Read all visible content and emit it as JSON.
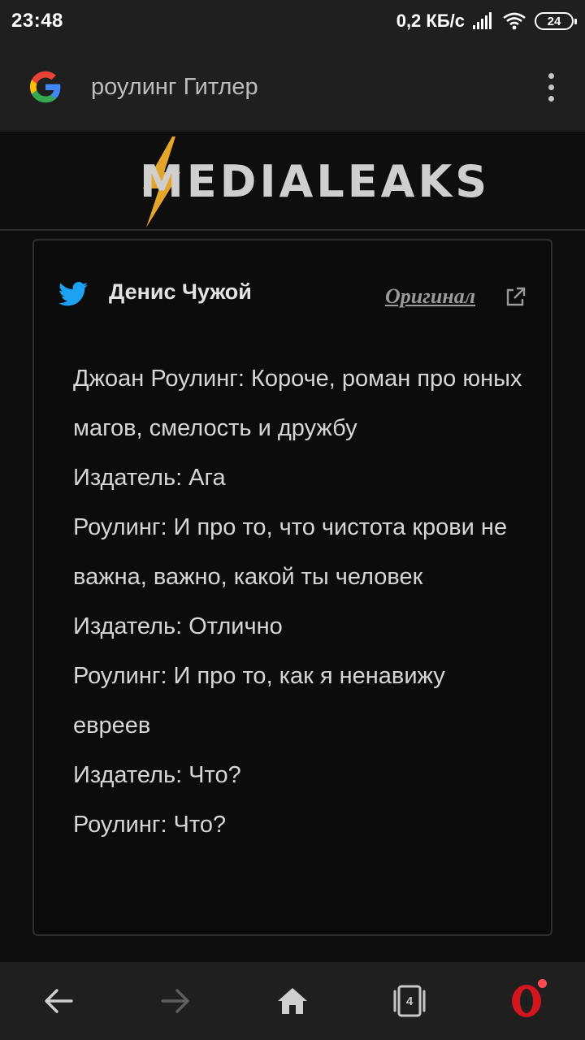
{
  "status_bar": {
    "time": "23:48",
    "speed": "0,2 КБ/с",
    "battery": "24",
    "icons": [
      "signal-icon",
      "wifi-icon",
      "battery-icon"
    ]
  },
  "search_bar": {
    "query": "роулинг Гитлер",
    "icons": [
      "google-logo-icon",
      "more-vertical-icon"
    ]
  },
  "site": {
    "logo_text": "MEDIALEAKS",
    "accent_color": "#e5a52a"
  },
  "tweet": {
    "author": "Денис Чужой",
    "original_label": "Оригинал",
    "lines": [
      "Джоан Роулинг: Короче, роман про юных магов, смелость и дружбу",
      "Издатель: Ага",
      "Роулинг: И про то, что чистота крови не важна, важно, какой ты человек",
      "Издатель: Отлично",
      "Роулинг: И про то, как я ненавижу евреев",
      "Издатель: Что?",
      "Роулинг: Что?"
    ],
    "twitter_color": "#1da1f2"
  },
  "nav_bar": {
    "tabs_count": "4",
    "icons": [
      "back-arrow-icon",
      "forward-arrow-icon",
      "home-icon",
      "tabs-icon",
      "opera-icon"
    ]
  }
}
